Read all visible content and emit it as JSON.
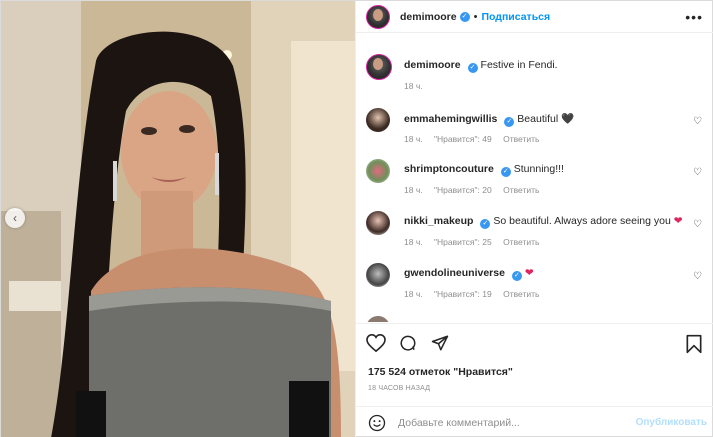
{
  "post": {
    "username": "demimoore",
    "follow_label": "Подписаться",
    "more_label": "•••",
    "verified_mark": "✓"
  },
  "caption": {
    "username": "demimoore",
    "text": "Festive in Fendi.",
    "time": "18 ч."
  },
  "comments": [
    {
      "username": "emmahemingwillis",
      "verified": true,
      "text": "Beautiful",
      "emoji": "🖤",
      "time": "18 ч.",
      "likes": "\"Нравится\": 49",
      "reply": "Ответить"
    },
    {
      "username": "shrimptoncouture",
      "verified": true,
      "text": "Stunning!!!",
      "emoji": "",
      "time": "18 ч.",
      "likes": "\"Нравится\": 20",
      "reply": "Ответить"
    },
    {
      "username": "nikki_makeup",
      "verified": true,
      "text": "So beautiful. Always adore seeing you",
      "emoji": "❤",
      "time": "18 ч.",
      "likes": "\"Нравится\": 25",
      "reply": "Ответить"
    },
    {
      "username": "gwendolineuniverse",
      "verified": true,
      "text": "",
      "emoji": "❤",
      "time": "18 ч.",
      "likes": "\"Нравится\": 19",
      "reply": "Ответить"
    }
  ],
  "actions": {
    "likes_count": "175 524 отметок \"Нравится\"",
    "posted": "18 ЧАСОВ НАЗАД"
  },
  "composer": {
    "placeholder": "Добавьте комментарий...",
    "publish_label": "Опубликовать"
  },
  "carousel": {
    "prev_label": "‹"
  },
  "colors": {
    "accent": "#0095f6",
    "verified": "#3897f0",
    "heart_red": "#e0245e"
  }
}
